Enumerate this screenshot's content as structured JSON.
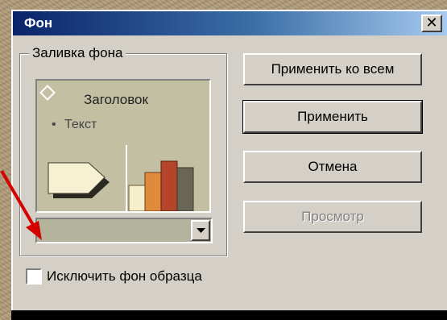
{
  "window": {
    "title": "Фон",
    "close_glyph": "✕"
  },
  "fill_group": {
    "label": "Заливка фона",
    "preview": {
      "title": "Заголовок",
      "bullet": "•",
      "text": "Текст"
    },
    "color_dropdown": {
      "value": ""
    }
  },
  "buttons": {
    "apply_all": "Применить ко всем",
    "apply": "Применить",
    "cancel": "Отмена",
    "preview": "Просмотр"
  },
  "checkbox": {
    "label": "Исключить фон образца",
    "checked": false
  },
  "colors": {
    "title_bar_start": "#0a246a",
    "title_bar_end": "#a6caf0",
    "dialog": "#d4d0c8",
    "preview_bg": "#c2bfa2",
    "dropdown_fill": "#b4b49c",
    "pointer_arrow": "#d40000"
  },
  "icons": [
    "close-icon",
    "diamond-icon",
    "arrow-shape-icon",
    "bar-chart-icon",
    "dropdown-arrow-icon",
    "pointer-arrow-icon"
  ]
}
